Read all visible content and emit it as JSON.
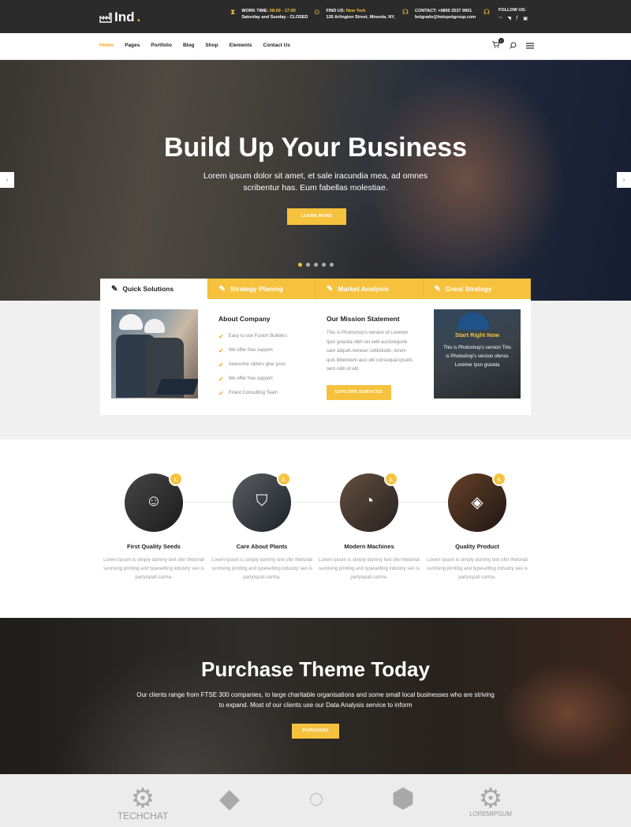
{
  "topbar": {
    "logo": "Ind",
    "logo_dot": ".",
    "work_label": "WORK TIME:",
    "work_hours": "08:00 - 17:00",
    "work_closed": "Saturday and Sunday - CLOSED",
    "find_label": "FIND US:",
    "find_city": "New York",
    "find_address": "126 Arlington Street, Mineola, NY,",
    "contact_label": "CONTACT:",
    "contact_phone": "+0800 2537 9901",
    "contact_email": "belgrado@hotspotgroup.com",
    "follow_label": "FOLLOW US:"
  },
  "nav": {
    "items": [
      "Home",
      "Pages",
      "Portfolio",
      "Blog",
      "Shop",
      "Elements",
      "Contact Us"
    ],
    "cart_count": "0"
  },
  "hero": {
    "title": "Build Up Your Business",
    "text": "Lorem ipsum dolor sit amet, et sale iracundia mea, ad omnes scribentur has. Eum fabellas molestiae.",
    "button": "LEARN MORE",
    "prev": "‹",
    "next": "›"
  },
  "tabs": [
    "Quick Solutions",
    "Strategy Planing",
    "Market Analysis",
    "Great Strategy"
  ],
  "panel": {
    "about_title": "About Company",
    "about_list": [
      "Easy to use Fusion Builders",
      "We offer free support",
      "Awesome sliders give yous",
      "We offer free support",
      "Finest Consulting Team"
    ],
    "mission_title": "Our Mission Statement",
    "mission_text": "This is Photoshop's version of Loremer Ipsn gravida nibh vel velit auctoregorie sam aliquet.Aenean sollicitudin, lorem quis bibendum auci elit consequat ipsutis sem nibh id elit.",
    "mission_button": "EXPLORE SERVICES",
    "promo_title": "Start Right Now",
    "promo_text": "This is Photoshop's version This is Photoshop's version ofersis Loremer Ipsn gravida"
  },
  "features": [
    {
      "num": "1.",
      "title": "First Quality Seeds",
      "text": "Lorem Ipsum is simply dummy text ofer thetonat sunrising printing and typesetting industry seo is partyispati carma.",
      "icon": "user-icon"
    },
    {
      "num": "2.",
      "title": "Care About Plants",
      "text": "Lorem Ipsum is simply dummy text ofer thetonat sunrising printing and typesetting industry seo is partyispati carma.",
      "icon": "shield-icon"
    },
    {
      "num": "3.",
      "title": "Modern Machines",
      "text": "Lorem Ipsum is simply dummy text ofer thetonat sunrising printing and typesetting industry seo is partyispati carma.",
      "icon": "gauge-icon"
    },
    {
      "num": "4.",
      "title": "Quality Product",
      "text": "Lorem Ipsum is simply dummy text ofer thetonat sunrising printing and typesetting industry seo is partyispati carma.",
      "icon": "layers-icon"
    }
  ],
  "purchase": {
    "title": "Purchase Theme Today",
    "text": "Our clients range from FTSE 300 companies, to large charitable organisations and some small local businesses who are striving to expand. Most of our clients use our Data Analysis service to inform",
    "button": "PURCHASE"
  },
  "logos": [
    "TECHCHAT",
    "",
    "",
    "",
    "LOREMIPSUM"
  ],
  "colors": {
    "accent": "#f6c23e",
    "dark": "#2b2b2b"
  }
}
